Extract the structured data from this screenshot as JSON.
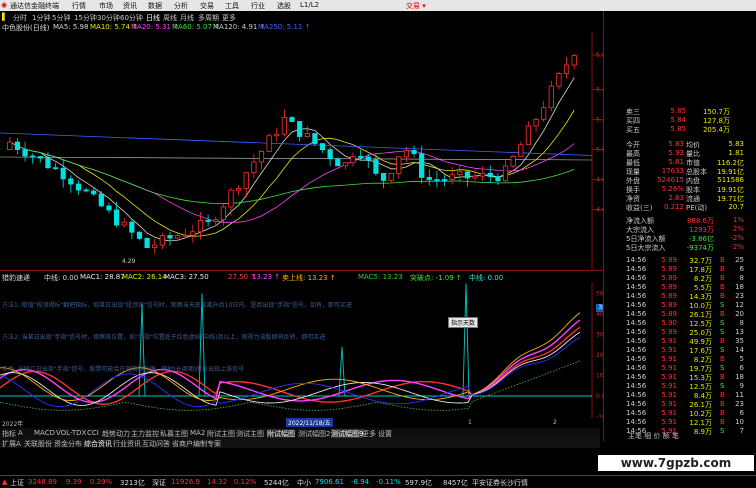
{
  "menu": {
    "app_title": "通达信金融终端",
    "items": [
      "行情",
      "市场",
      "资讯",
      "数据",
      "分析",
      "交易",
      "工具",
      "行业",
      "选股",
      "L1/L2"
    ],
    "account": "交易 ▾"
  },
  "timeframes": [
    "分时",
    "1分钟",
    "5分钟",
    "15分钟",
    "30分钟",
    "60分钟",
    "日线",
    "周线",
    "月线",
    "多周期",
    "更多"
  ],
  "ma_legend": {
    "stock": "中色股份(日线)",
    "items": [
      {
        "label": "MA5: 5.98",
        "color": "#d8d8d8"
      },
      {
        "label": "MA10: 5.74 ↑",
        "color": "#e8e800"
      },
      {
        "label": "MA20: 5.31 ↑",
        "color": "#ff40ff"
      },
      {
        "label": "MA60: 5.07 ↑",
        "color": "#40e040"
      },
      {
        "label": "MA120: 4.91 ↑",
        "color": "#cccccc"
      },
      {
        "label": "MA250: 5.11 ↑",
        "color": "#4060ff"
      }
    ]
  },
  "price_axis": [
    "5.63",
    "5.40",
    "5.20",
    "5.00",
    "4.80",
    "4.60"
  ],
  "low_marker": "4.29",
  "indicator_legend": {
    "name": "猎豹速递",
    "items": [
      {
        "label": "中线: 0.00",
        "color": "#d8d8d8"
      },
      {
        "label": "MAC1: 28.87",
        "color": "#e8e8e8"
      },
      {
        "label": "MAC2: 26.14",
        "color": "#e8e800"
      },
      {
        "label": "MAC3: 27.50",
        "color": "#e8e8e8"
      },
      {
        "label": "27.50 ↑",
        "color": "#ff4040"
      },
      {
        "label": "13.23 ↑",
        "color": "#ff40ff"
      },
      {
        "label": "卖上线: 13.23 ↑",
        "color": "#ffb000"
      },
      {
        "label": "MAC5: 13.23",
        "color": "#40c040"
      },
      {
        "label": "突破点: -1.09 ↑",
        "color": "#40e040"
      },
      {
        "label": "中线: 0.00",
        "color": "#40e0e0"
      }
    ]
  },
  "indicator_axis": [
    "50.00",
    "40.00",
    "30.00",
    "20.00",
    "10.00",
    "0.00",
    "-10.00"
  ],
  "indicator_tag": "38.58",
  "annotations": [
    "方法1: 取值\"段顶揭标\"翻把指标，如某日出现\"段顶见\"信号时，观察当天底部离升后10日内，是否出现\"手指\"信号，如有，即可买进",
    "方法2: 当某日出现\"手指\"信号时，观察其位置，如\"手指\"位置处于红色虚线(中线)及以上，则视为该股即将反转，即可买进",
    "条件: 当短几日出现\"手指\"信号，股票可能会在短期内反弹，同时(长周期)股价出现上涨信号"
  ],
  "popup_label": "指示天数",
  "date_labels": [
    "2022年",
    "2022/11/18/五",
    "1",
    "2"
  ],
  "indicator_tabs": [
    "指标",
    "A",
    "MACD",
    "VOL-TDX",
    "CCI",
    "趋势动力",
    "主力监控",
    "私募主图",
    "MA2",
    "附试主图",
    "测试主图",
    "附试幅图",
    "测试幅图2",
    "测试幅图9",
    "更多",
    "设置"
  ],
  "func_tabs": [
    "扩展A",
    "关联股份",
    "资金分布",
    "综合资讯",
    "行业资讯",
    "互动问答",
    "省商户编制专案"
  ],
  "right_panel": {
    "orderbook": [
      {
        "label": "卖三",
        "price": "5.85",
        "vol": "150.7万"
      },
      {
        "label": "买四",
        "price": "5.84",
        "vol": "127.8万"
      },
      {
        "label": "买五",
        "price": "5.85",
        "vol": "205.4万"
      }
    ],
    "quote": [
      {
        "a": "今开",
        "av": "5.83",
        "b": "均价",
        "bv": "5.83"
      },
      {
        "a": "最高",
        "av": "5.93",
        "b": "量比",
        "bv": "1.81"
      },
      {
        "a": "最低",
        "av": "5.81",
        "b": "市值",
        "bv": "116.2亿"
      },
      {
        "a": "现量",
        "av": "17633",
        "b": "总股本",
        "bv": "19.91亿"
      },
      {
        "a": "外盘",
        "av": "524615",
        "b": "内盘",
        "bv": "511586"
      },
      {
        "a": "换手",
        "av": "5.26%",
        "b": "股本",
        "bv": "19.91亿"
      },
      {
        "a": "净资",
        "av": "2.63",
        "b": "流通",
        "bv": "19.71亿"
      },
      {
        "a": "收益(三)",
        "av": "0.212",
        "b": "PE(动)",
        "bv": "20.7"
      }
    ],
    "flow": [
      {
        "label": "净流入额",
        "val": "888.6万",
        "pct": "1%"
      },
      {
        "label": "大宗流入",
        "val": "1293万",
        "pct": "2%"
      },
      {
        "label": "5日净流入额",
        "val": "-3.86亿",
        "pct": "-2%"
      },
      {
        "label": "5日大宗流入",
        "val": "-9374万",
        "pct": "-2%"
      }
    ],
    "ticks": [
      [
        "14:56",
        "5.89",
        "32.7万",
        "B",
        "25"
      ],
      [
        "14:56",
        "5.89",
        "17.8万",
        "B",
        "6"
      ],
      [
        "14:56",
        "5.89",
        "8.2万",
        "B",
        "8"
      ],
      [
        "14:56",
        "5.89",
        "5.5万",
        "B",
        "18"
      ],
      [
        "14:56",
        "5.89",
        "14.3万",
        "B",
        "23"
      ],
      [
        "14:56",
        "5.89",
        "10.0万",
        "S",
        "12"
      ],
      [
        "14:56",
        "5.89",
        "26.1万",
        "B",
        "20"
      ],
      [
        "14:56",
        "5.90",
        "12.5万",
        "S",
        "8"
      ],
      [
        "14:56",
        "5.89",
        "25.0万",
        "S",
        "13"
      ],
      [
        "14:56",
        "5.91",
        "49.9万",
        "B",
        "35"
      ],
      [
        "14:56",
        "5.91",
        "17.6万",
        "S",
        "14"
      ],
      [
        "14:56",
        "5.91",
        "8.2万",
        "B",
        "5"
      ],
      [
        "14:56",
        "5.91",
        "19.7万",
        "S",
        "6"
      ],
      [
        "14:56",
        "5.91",
        "15.3万",
        "B",
        "18"
      ],
      [
        "14:56",
        "5.91",
        "12.5万",
        "S",
        "9"
      ],
      [
        "14:56",
        "5.91",
        "8.4万",
        "B",
        "11"
      ],
      [
        "14:56",
        "5.91",
        "26.1万",
        "B",
        "23"
      ],
      [
        "14:56",
        "5.91",
        "10.2万",
        "B",
        "6"
      ],
      [
        "14:56",
        "5.91",
        "12.1万",
        "B",
        "10"
      ],
      [
        "14:56",
        "5.91",
        "8.9万",
        "S",
        "7"
      ],
      [
        "14:56",
        "5.91",
        "15.0万",
        "B",
        "14"
      ],
      [
        "14:56",
        "5.91",
        "8.6万",
        "B",
        "5"
      ],
      [
        "14:56",
        "5.92",
        "29.4万",
        "B",
        "26"
      ],
      [
        "14:56",
        "5.92",
        "9.1万",
        "B",
        "8"
      ],
      [
        "14:56",
        "5.91",
        "17.6万",
        "B",
        "13"
      ]
    ],
    "bottom_tabs": "主笔 细 价 额 笔"
  },
  "statusbar": {
    "idx1_name": "上证",
    "idx1_val": "3248.89",
    "idx1_chg": "9.39",
    "idx1_pct": "0.29%",
    "idx1_amt": "3213亿",
    "idx2_name": "深证",
    "idx2_val": "11926.9",
    "idx2_chg": "14.32",
    "idx2_pct": "0.12%",
    "idx2_amt": "5244亿",
    "idx3_name": "中小",
    "idx3_val": "7906.61",
    "idx3_chg": "-8.94",
    "idx3_pct": "-0.11%",
    "idx3_amt": "597.9亿",
    "total": "8457亿",
    "broker": "平安证券长沙行情"
  },
  "watermark": "www.7gpzb.com",
  "colors": {
    "up": "#ff3030",
    "down": "#00e0e0",
    "grid": "#8a1010",
    "cyan": "#00c8c8"
  }
}
